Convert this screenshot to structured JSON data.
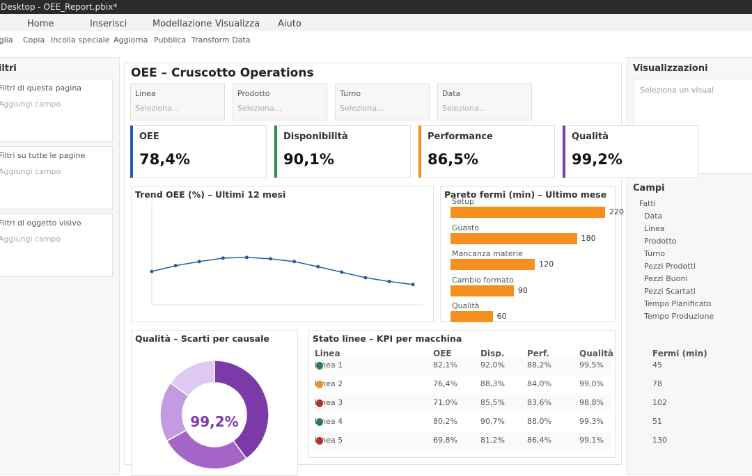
{
  "window": {
    "title": "Desktop - OEE_Report.pbix*"
  },
  "menu": [
    "Home",
    "Inserisci",
    "Modellazione",
    "Visualizza",
    "Aiuto"
  ],
  "toolbar": [
    "Taglia",
    "Copia",
    "Incolla speciale",
    "Aggiorna",
    "Pubblica",
    "Transform Data"
  ],
  "filters": {
    "title": "Filtri",
    "sections": [
      {
        "title": "Filtri di questa pagina",
        "placeholder": "Aggiungi campo"
      },
      {
        "title": "Filtri su tutte le pagine",
        "placeholder": "Aggiungi campo"
      },
      {
        "title": "Filtri di oggetto visivo",
        "placeholder": "Aggiungi campo"
      }
    ]
  },
  "report": {
    "title": "OEE – Cruscotto Operations",
    "slicers": [
      {
        "label": "Linea",
        "placeholder": "Seleziona..."
      },
      {
        "label": "Prodotto",
        "placeholder": "Seleziona..."
      },
      {
        "label": "Turno",
        "placeholder": "Seleziona..."
      },
      {
        "label": "Data",
        "placeholder": "Seleziona..."
      }
    ],
    "kpis": [
      {
        "label": "OEE",
        "value": "78,4%",
        "color": "#1f5fa0"
      },
      {
        "label": "Disponibilità",
        "value": "90,1%",
        "color": "#2e8b57"
      },
      {
        "label": "Performance",
        "value": "86,5%",
        "color": "#f5901e"
      },
      {
        "label": "Qualità",
        "value": "99,2%",
        "color": "#7b3aa8"
      }
    ],
    "donut_title": "Qualità – Scarti per causale",
    "donut_center": "99,2%",
    "table": {
      "title": "Stato linee – KPI per macchina",
      "headers": [
        "Linea",
        "OEE",
        "Disp.",
        "Perf.",
        "Qualità",
        "Fermi (min)"
      ],
      "rows": [
        {
          "status": "#2e7d4f",
          "cells": [
            "Linea 1",
            "82,1%",
            "92,0%",
            "88,2%",
            "99,5%",
            "45"
          ]
        },
        {
          "status": "#f0901e",
          "cells": [
            "Linea 2",
            "76,4%",
            "88,3%",
            "84,0%",
            "99,0%",
            "78"
          ]
        },
        {
          "status": "#b03030",
          "cells": [
            "Linea 3",
            "71,0%",
            "85,5%",
            "83,6%",
            "98,8%",
            "102"
          ]
        },
        {
          "status": "#2e7d4f",
          "cells": [
            "Linea 4",
            "80,2%",
            "90,7%",
            "88,0%",
            "99,3%",
            "51"
          ]
        },
        {
          "status": "#b03030",
          "cells": [
            "Linea 5",
            "69,8%",
            "81,2%",
            "86,4%",
            "99,1%",
            "130"
          ]
        }
      ]
    }
  },
  "visualizations": {
    "title": "Visualizzazioni",
    "placeholder": "Seleziona un visual",
    "fields_title": "Campi",
    "table": "Fatti",
    "fields": [
      "Data",
      "Linea",
      "Prodotto",
      "Turno",
      "Pezzi Prodotti",
      "Pezzi Buoni",
      "Pezzi Scartati",
      "Tempo Pianificato",
      "Tempo Produzione"
    ]
  },
  "chart_data": [
    {
      "type": "line",
      "title": "Trend OEE (%) – Ultimi 12 mesi",
      "color": "#1f5fa0",
      "ylim": [
        60,
        90
      ],
      "grid": false,
      "values": [
        69.7,
        71.4,
        72.6,
        73.6,
        73.8,
        73.4,
        72.6,
        71.1,
        69.5,
        67.9,
        66.8,
        65.9
      ]
    },
    {
      "type": "bar",
      "orientation": "horizontal",
      "title": "Pareto fermi (min) – Ultimo mese",
      "color": "#f5901e",
      "categories": [
        "Setup",
        "Guasto",
        "Mancanza materie",
        "Cambio formato",
        "Qualità"
      ],
      "values": [
        220,
        180,
        120,
        90,
        60
      ]
    },
    {
      "type": "pie",
      "donut": true,
      "values": [
        40,
        27,
        18,
        15
      ],
      "colors": [
        "#7b3aa8",
        "#a366c8",
        "#c49be0",
        "#dfc8f2"
      ]
    }
  ]
}
